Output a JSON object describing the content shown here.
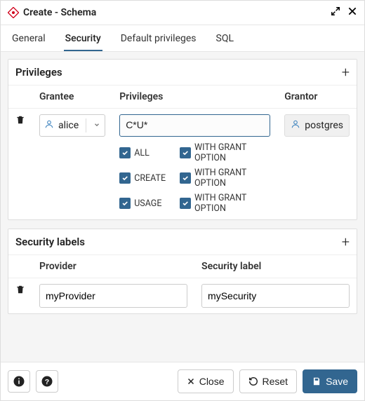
{
  "title": "Create - Schema",
  "tabs": [
    "General",
    "Security",
    "Default privileges",
    "SQL"
  ],
  "active_tab": "Security",
  "privileges": {
    "title": "Privileges",
    "columns": [
      "Grantee",
      "Privileges",
      "Grantor"
    ],
    "rows": [
      {
        "grantee": "alice",
        "priv_string": "C*U*",
        "grantor": "postgres"
      }
    ],
    "checks": [
      {
        "left": "ALL",
        "left_checked": true,
        "right": "WITH GRANT OPTION",
        "right_checked": true
      },
      {
        "left": "CREATE",
        "left_checked": true,
        "right": "WITH GRANT OPTION",
        "right_checked": true
      },
      {
        "left": "USAGE",
        "left_checked": true,
        "right": "WITH GRANT OPTION",
        "right_checked": true
      }
    ]
  },
  "security_labels": {
    "title": "Security labels",
    "columns": [
      "Provider",
      "Security label"
    ],
    "rows": [
      {
        "provider": "myProvider",
        "label": "mySecurity"
      }
    ]
  },
  "footer": {
    "close": "Close",
    "reset": "Reset",
    "save": "Save"
  },
  "colors": {
    "accent": "#326690",
    "icon_user": "#4a8bc2",
    "panel_bg": "#f5f5f5"
  }
}
